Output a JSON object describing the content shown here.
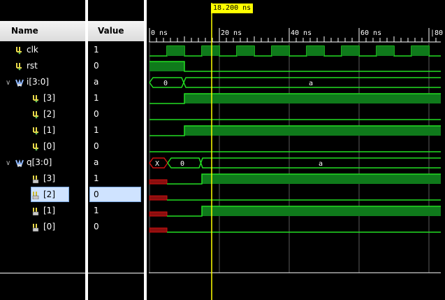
{
  "header": {
    "name_label": "Name",
    "value_label": "Value"
  },
  "signals": [
    {
      "name": "clk",
      "value": "1",
      "kind": "bit",
      "indent": 0
    },
    {
      "name": "rst",
      "value": "0",
      "kind": "bit",
      "indent": 0
    },
    {
      "name": "i[3:0]",
      "value": "a",
      "kind": "bus",
      "indent": 0,
      "expanded": true
    },
    {
      "name": "[3]",
      "value": "1",
      "kind": "bit",
      "indent": 1
    },
    {
      "name": "[2]",
      "value": "0",
      "kind": "bit",
      "indent": 1
    },
    {
      "name": "[1]",
      "value": "1",
      "kind": "bit",
      "indent": 1
    },
    {
      "name": "[0]",
      "value": "0",
      "kind": "bit",
      "indent": 1
    },
    {
      "name": "q[3:0]",
      "value": "a",
      "kind": "bus",
      "indent": 0,
      "expanded": true
    },
    {
      "name": "[3]",
      "value": "1",
      "kind": "bit",
      "indent": 1
    },
    {
      "name": "[2]",
      "value": "0",
      "kind": "bit",
      "indent": 1,
      "selected": true
    },
    {
      "name": "[1]",
      "value": "1",
      "kind": "bit",
      "indent": 1
    },
    {
      "name": "[0]",
      "value": "0",
      "kind": "bit",
      "indent": 1
    }
  ],
  "timeline": {
    "ticks": [
      "0 ns",
      "20 ns",
      "40 ns",
      "60 ns",
      "|80"
    ],
    "cursor_label": "18.200 ns"
  },
  "bus_values": {
    "i": [
      "0",
      "a"
    ],
    "q": [
      "X",
      "0",
      "a"
    ]
  },
  "colors": {
    "wave": "#22dd22",
    "fill": "#0f7a1b",
    "undefined": "#cc1111",
    "cursor": "#ffff00",
    "background": "#000000"
  }
}
